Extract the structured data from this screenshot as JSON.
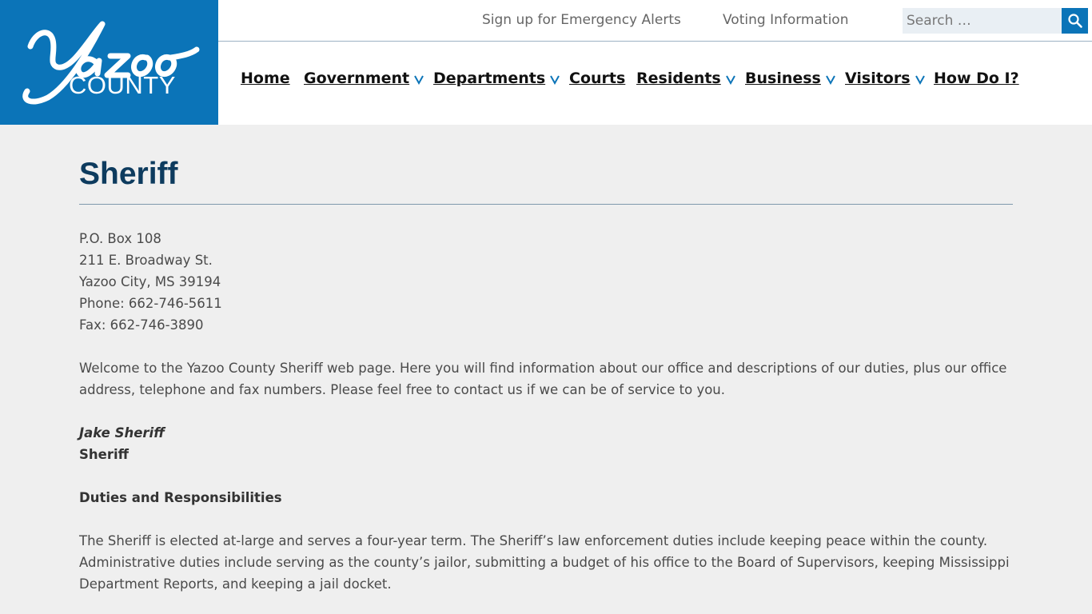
{
  "brand": {
    "script_word": "Yazoo",
    "county_word": "COUNTY",
    "color": "#0b74b8"
  },
  "utility": {
    "alerts_label": "Sign up for Emergency Alerts",
    "voting_label": "Voting Information",
    "search_placeholder": "Search …"
  },
  "nav": {
    "items": [
      {
        "label": "Home",
        "has_dropdown": false
      },
      {
        "label": "Government",
        "has_dropdown": true
      },
      {
        "label": "Departments",
        "has_dropdown": true
      },
      {
        "label": "Courts",
        "has_dropdown": false
      },
      {
        "label": "Residents",
        "has_dropdown": true
      },
      {
        "label": "Business",
        "has_dropdown": true
      },
      {
        "label": "Visitors",
        "has_dropdown": true
      },
      {
        "label": "How Do I?",
        "has_dropdown": false
      }
    ]
  },
  "page": {
    "title": "Sheriff",
    "address": [
      "P.O. Box 108",
      "211 E. Broadway St.",
      "Yazoo City, MS 39194",
      "Phone: 662-746-5611",
      "Fax: 662-746-3890"
    ],
    "welcome": "Welcome to the Yazoo County Sheriff web page.  Here you will find information about our office and descriptions of our duties, plus our office address, telephone and fax numbers.  Please feel free to contact us if we can be of service to you.",
    "official_name": "Jake Sheriff",
    "official_role": "Sheriff",
    "duties_heading": "Duties and Responsibilities",
    "duties_text": "The Sheriff is elected at-large and serves a four-year term.  The Sheriff’s law enforcement duties include keeping peace within the county.  Administrative duties include serving as the county’s jailor, submitting a budget of his office to the Board of Supervisors, keeping Mississippi Department Reports, and keeping a jail docket."
  },
  "colors": {
    "accent": "#0b74b8",
    "title": "#0d3b5e",
    "background": "#efefef"
  }
}
